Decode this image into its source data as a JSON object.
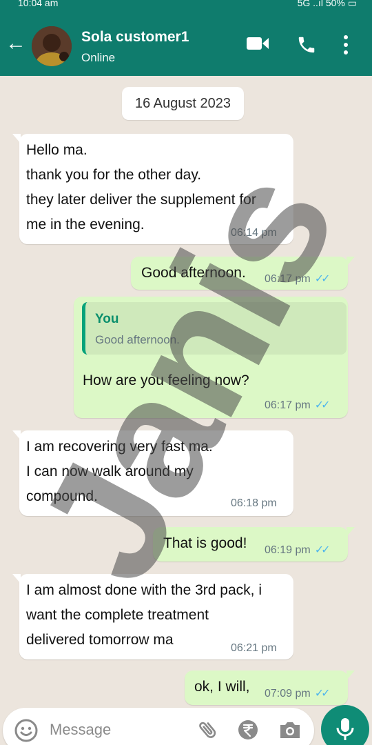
{
  "status_bar": {
    "time": "10:04 am",
    "network": "5G",
    "battery": "50%"
  },
  "header": {
    "contact_name": "Sola customer1",
    "status": "Online"
  },
  "date_separator": "16 August 2023",
  "messages": [
    {
      "direction": "in",
      "text": "Hello ma.\nthank you for the other day.\nthey later deliver the supplement for\nme in the evening.",
      "time": "06:14 pm"
    },
    {
      "direction": "out",
      "text": "Good afternoon.",
      "time": "06:17 pm"
    },
    {
      "direction": "out",
      "quote": {
        "author": "You",
        "text": "Good afternoon."
      },
      "text": "How are you feeling now?",
      "time": "06:17 pm"
    },
    {
      "direction": "in",
      "text": "I am recovering very fast ma.\nI can now walk around my\ncompound.",
      "time": "06:18 pm"
    },
    {
      "direction": "out",
      "text": "That is good!",
      "time": "06:19 pm"
    },
    {
      "direction": "in",
      "text": "I am almost done with the 3rd pack, i\nwant the complete treatment\ndelivered tomorrow ma",
      "time": "06:21 pm"
    },
    {
      "direction": "out",
      "text": "ok, I will,",
      "time": "07:09 pm"
    }
  ],
  "composer": {
    "placeholder": "Message"
  },
  "watermark": "Janis",
  "colors": {
    "header": "#0f7c6d",
    "outgoing_bubble": "#dcf8c6",
    "incoming_bubble": "#ffffff",
    "read_ticks": "#4fb6ec",
    "background": "#ece5dd"
  }
}
